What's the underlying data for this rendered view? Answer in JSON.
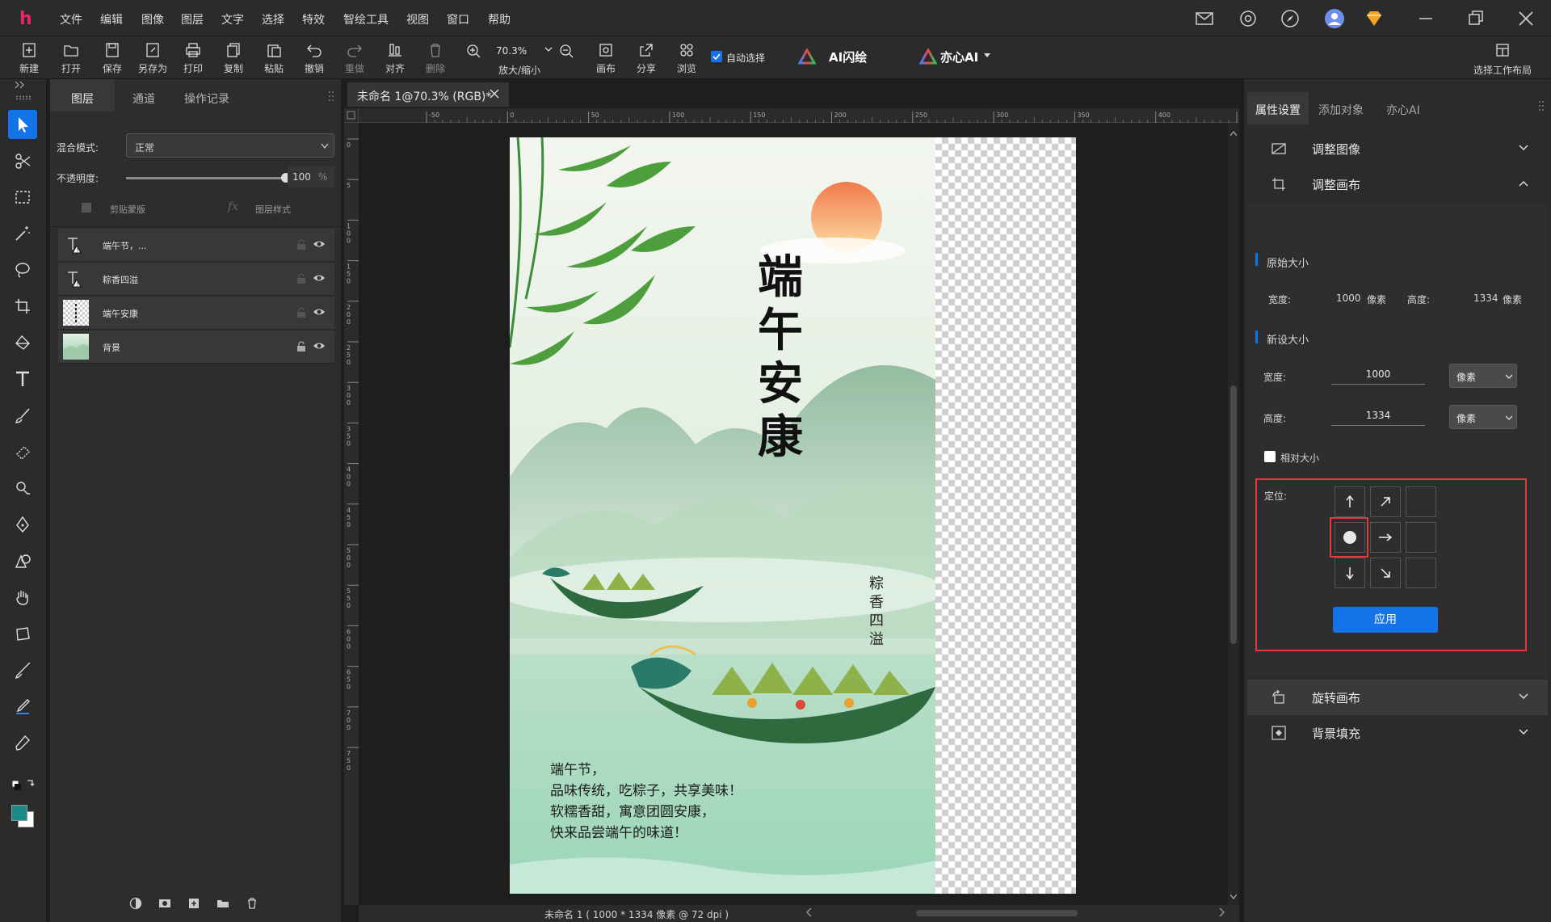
{
  "app": {
    "logo": "h"
  },
  "menu": [
    "文件",
    "编辑",
    "图像",
    "图层",
    "文字",
    "选择",
    "特效",
    "智绘工具",
    "视图",
    "窗口",
    "帮助"
  ],
  "toolbar": {
    "new": "新建",
    "open": "打开",
    "save": "保存",
    "save_as": "另存为",
    "print": "打印",
    "copy": "复制",
    "paste": "粘贴",
    "undo": "撤销",
    "redo": "重做",
    "align": "对齐",
    "delete": "删除",
    "zoom_value": "70.3%",
    "zoom_label": "放大/缩小",
    "canvas": "画布",
    "share": "分享",
    "browse": "浏览",
    "auto_select": "自动选择",
    "ai_flash": "AI闪绘",
    "yixin_ai": "亦心AI",
    "workspace": "选择工作布局"
  },
  "layers_panel": {
    "tabs": [
      "图层",
      "通道",
      "操作记录"
    ],
    "blend_label": "混合模式:",
    "blend_value": "正常",
    "opacity_label": "不透明度:",
    "opacity_value": "100",
    "opacity_unit": "%",
    "opacity_level": 1.0,
    "clip_mask": "剪贴蒙版",
    "layer_style": "图层样式",
    "layers": [
      {
        "name": "端午节，...",
        "type": "text"
      },
      {
        "name": "粽香四溢",
        "type": "text"
      },
      {
        "name": "端午安康",
        "type": "image"
      },
      {
        "name": "背景",
        "type": "image"
      }
    ]
  },
  "document": {
    "tab_title": "未命名 1@70.3% (RGB)*",
    "ruler_h": [
      "-50",
      "0",
      "50",
      "100",
      "150",
      "200",
      "250",
      "300",
      "350",
      "400",
      "45"
    ],
    "ruler_v": [
      "0",
      "5",
      "1 0 0",
      "1 5 0",
      "2 0 0",
      "2 5 0",
      "3 0 0",
      "3 5 0",
      "4 0 0",
      "4 5 0",
      "5 0 0",
      "5 5 0",
      "6 0 0",
      "6 5 0",
      "7 0 0",
      "7 5 0"
    ],
    "status": "未命名 1 ( 1000 * 1334 像素 @ 72 dpi )"
  },
  "poster": {
    "title": "端午安康",
    "vertical_text": "粽香四溢",
    "body_lines": [
      "端午节，",
      "品味传统，吃粽子，共享美味！",
      "软糯香甜，寓意团圆安康，",
      "快来品尝端午的味道！"
    ]
  },
  "right_panel": {
    "tabs": [
      "属性设置",
      "添加对象",
      "亦心AI"
    ],
    "adjust_image": "调整图像",
    "adjust_canvas": "调整画布",
    "original_size": "原始大小",
    "width_label": "宽度:",
    "height_label": "高度:",
    "orig_width": "1000",
    "orig_height": "1334",
    "unit": "像素",
    "new_size": "新设大小",
    "new_width": "1000",
    "new_height": "1334",
    "relative": "相对大小",
    "anchor_label": "定位:",
    "apply": "应用",
    "rotate_canvas": "旋转画布",
    "bg_fill": "背景填充"
  },
  "colors": {
    "accent": "#1473e6",
    "highlight": "#e03b3b",
    "foreground": "#1b8a8a",
    "background": "#ffffff"
  }
}
